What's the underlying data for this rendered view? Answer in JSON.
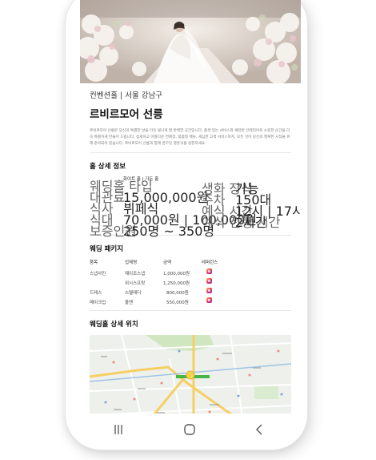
{
  "venue": {
    "subtitle": "컨벤션홀 | 서울 강남구",
    "title": "르비르모어 선릉",
    "description": "르비르모어 선릉은 당신의 특별한 날을 더욱 빛나게 할 완벽한 공간입니다. 품격 있는 서비스와 세련된 인테리어로 소중한 순간을 더욱 특별하게 만들어 드립니다. 섬세하고 아름다운 연회장, 맞춤형 메뉴, 세심한 고객 서비스까지, 모든 것이 당신의 행복한 시작을 위해 준비되어 있습니다. 르비르모어 선릉과 함께 꿈꾸던 결혼식을 실현하세요."
  },
  "hall_detail": {
    "title": "홀 상세 정보",
    "left": [
      {
        "label": "웨딩홀 타입",
        "value": "화이트 홀 | 가든 홀"
      },
      {
        "label": "대관료",
        "value": "15,000,000원"
      },
      {
        "label": "식사",
        "value": "뷔페식"
      },
      {
        "label": "식대",
        "value": "70,000원 | 100,000원"
      },
      {
        "label": "보증인원",
        "value": "250명 ~ 350명"
      }
    ],
    "right": [
      {
        "label": "생화 장식",
        "value": "가능"
      },
      {
        "label": "주차",
        "value": "150대"
      },
      {
        "label": "예식 시간",
        "value": "12시 | 17시"
      },
      {
        "label": "예식 진행 시간",
        "value": "2시간"
      }
    ]
  },
  "package": {
    "title": "웨딩 패키지",
    "headers": [
      "품목",
      "업체명",
      "금액",
      "레퍼런스"
    ],
    "rows": [
      {
        "item": "스냅사진",
        "vendor": "제이조스냅",
        "price": "1,000,000원",
        "ref": "instagram-icon"
      },
      {
        "item": "",
        "vendor": "위시스프랑",
        "price": "1,250,000원",
        "ref": "instagram-icon"
      },
      {
        "item": "드레스",
        "vendor": "스텔레더",
        "price": "800,000원",
        "ref": "instagram-icon"
      },
      {
        "item": "메이크업",
        "vendor": "올앤",
        "price": "550,000원",
        "ref": "instagram-icon"
      }
    ]
  },
  "location": {
    "title": "웨딩홀 상세 위치"
  },
  "colors": {
    "map_road": "#f6cf63",
    "map_park": "#cfe6c0",
    "map_subway": "#46b446",
    "instagram": "#e1306c"
  },
  "nav": {
    "recent_icon": "recent-apps-icon",
    "home_icon": "home-icon",
    "back_icon": "back-icon"
  }
}
